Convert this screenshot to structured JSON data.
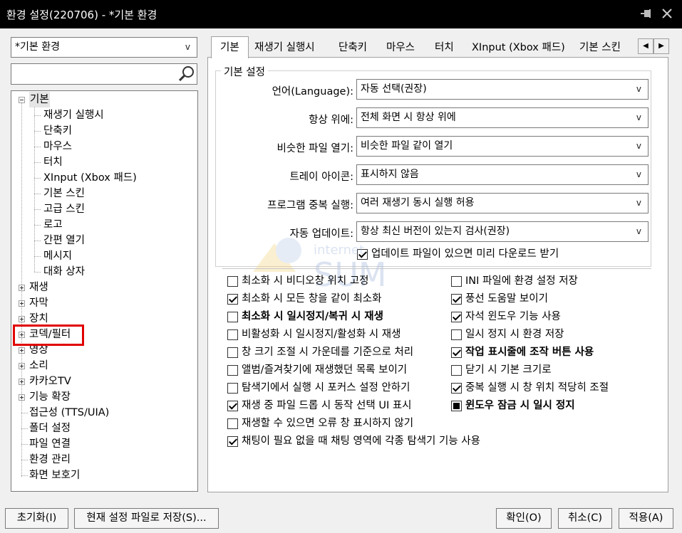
{
  "window": {
    "title": "환경 설정(220706) - *기본 환경"
  },
  "preset": {
    "value": "*기본 환경"
  },
  "search": {
    "value": ""
  },
  "tree": {
    "items": [
      {
        "label": "기본"
      },
      {
        "label": "재생기 실행시"
      },
      {
        "label": "단축키"
      },
      {
        "label": "마우스"
      },
      {
        "label": "터치"
      },
      {
        "label": "XInput (Xbox 패드)"
      },
      {
        "label": "기본 스킨"
      },
      {
        "label": "고급 스킨"
      },
      {
        "label": "로고"
      },
      {
        "label": "간편 열기"
      },
      {
        "label": "메시지"
      },
      {
        "label": "대화 상자"
      },
      {
        "label": "재생"
      },
      {
        "label": "자막"
      },
      {
        "label": "장치"
      },
      {
        "label": "코덱/필터"
      },
      {
        "label": "영상"
      },
      {
        "label": "소리"
      },
      {
        "label": "카카오TV"
      },
      {
        "label": "기능 확장"
      },
      {
        "label": "접근성 (TTS/UIA)"
      },
      {
        "label": "폴더 설정"
      },
      {
        "label": "파일 연결"
      },
      {
        "label": "환경 관리"
      },
      {
        "label": "화면 보호기"
      }
    ]
  },
  "tabs": [
    {
      "label": "기본"
    },
    {
      "label": "재생기 실행시"
    },
    {
      "label": "단축키"
    },
    {
      "label": "마우스"
    },
    {
      "label": "터치"
    },
    {
      "label": "XInput (Xbox 패드)"
    },
    {
      "label": "기본 스킨"
    }
  ],
  "group": {
    "title": "기본 설정"
  },
  "fields": [
    {
      "label": "언어(Language):",
      "value": "자동 선택(권장)"
    },
    {
      "label": "항상 위에:",
      "value": "전체 화면 시 항상 위에"
    },
    {
      "label": "비슷한 파일 열기:",
      "value": "비슷한 파일 같이 열기"
    },
    {
      "label": "트레이 아이콘:",
      "value": "표시하지 않음"
    },
    {
      "label": "프로그램 중복 실행:",
      "value": "여러 재생기 동시 실행 허용"
    },
    {
      "label": "자동 업데이트:",
      "value": "항상 최신 버전이 있는지 검사(권장)"
    }
  ],
  "update_download": {
    "label": "업데이트 파일이 있으면 미리 다운로드 받기"
  },
  "checks_left": [
    {
      "label": "최소화 시 비디오창 위치 고정"
    },
    {
      "label": "최소화 시 모든 창을 같이 최소화"
    },
    {
      "label": "최소화 시 일시정지/복귀 시 재생"
    },
    {
      "label": "비활성화 시 일시정지/활성화 시 재생"
    },
    {
      "label": "창 크기 조절 시 가운데를 기준으로 처리"
    },
    {
      "label": "앨범/즐겨찾기에 재생했던 목록 보이기"
    },
    {
      "label": "탐색기에서 실행 시 포커스 설정 안하기"
    },
    {
      "label": "재생 중 파일 드롭 시 동작 선택 UI 표시"
    },
    {
      "label": "재생할 수 있으면 오류 창 표시하지 않기"
    },
    {
      "label": "채팅이 필요 없을 때 채팅 영역에 각종 탐색기 기능 사용"
    }
  ],
  "checks_right": [
    {
      "label": "INI 파일에 환경 설정 저장"
    },
    {
      "label": "풍선 도움말 보이기"
    },
    {
      "label": "자석 윈도우 기능 사용"
    },
    {
      "label": "일시 정지 시 환경 저장"
    },
    {
      "label": "작업 표시줄에 조작 버튼 사용"
    },
    {
      "label": "닫기 시 기본 크기로"
    },
    {
      "label": "중복 실행 시 창 위치 적당히 조절"
    },
    {
      "label": "윈도우 잠금 시 일시 정지"
    }
  ],
  "buttons": {
    "reset": "초기화(I)",
    "save_as": "현재 설정 파일로 저장(S)...",
    "ok": "확인(O)",
    "cancel": "취소(C)",
    "apply": "적용(A)"
  },
  "colors": {
    "highlight": "#e00000",
    "titlebar": "#000000"
  }
}
